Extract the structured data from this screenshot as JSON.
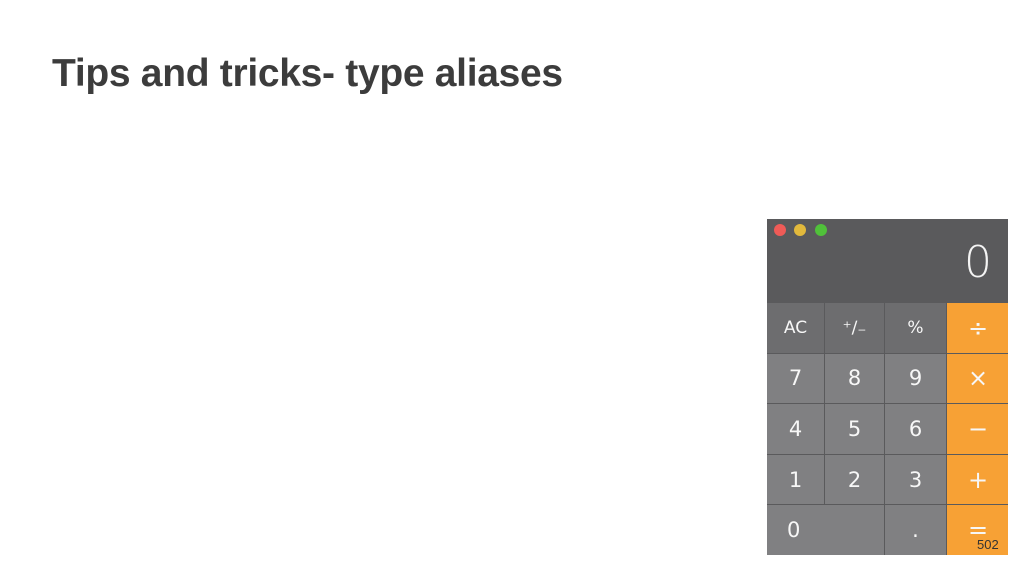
{
  "slide": {
    "title": "Tips and tricks- type aliases",
    "number": "502"
  },
  "calculator": {
    "display_value": "0",
    "window_controls": [
      "close",
      "minimize",
      "zoom"
    ],
    "colors": {
      "body": "#5a5a5c",
      "function_key": "#6d6d6f",
      "number_key": "#808082",
      "operator_key": "#f7a135",
      "close": "#ef5b57",
      "minimize": "#e2b93c",
      "zoom": "#50c13a"
    },
    "keys": {
      "ac": "AC",
      "plus_minus": "⁺∕₋",
      "percent": "%",
      "divide": "÷",
      "seven": "7",
      "eight": "8",
      "nine": "9",
      "multiply": "×",
      "four": "4",
      "five": "5",
      "six": "6",
      "minus": "−",
      "one": "1",
      "two": "2",
      "three": "3",
      "plus": "+",
      "zero": "0",
      "decimal": ".",
      "equals": "="
    }
  }
}
